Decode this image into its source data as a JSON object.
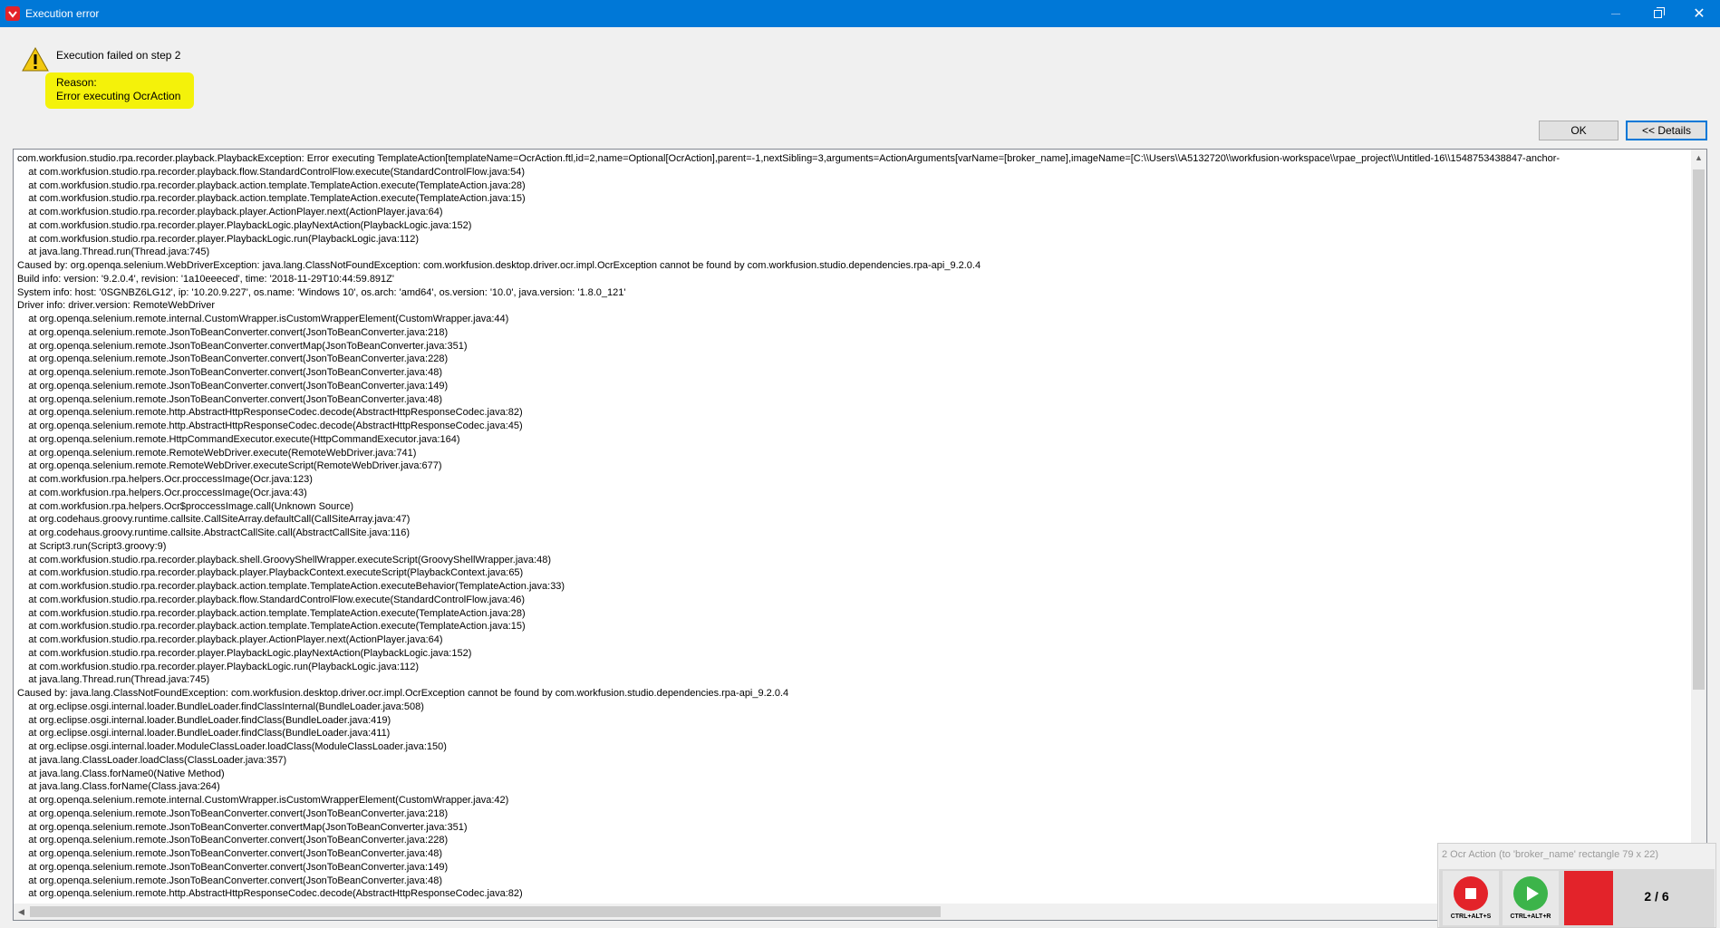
{
  "window": {
    "title": "Execution error",
    "close_symbol": "✕",
    "colors": {
      "titlebar": "#0078d7",
      "highlight": "#f4f20a",
      "stop": "#e3232a",
      "play": "#3cb44a"
    }
  },
  "message": {
    "main": "Execution failed on step 2",
    "reason_label": "Reason:",
    "reason_value": "Error executing OcrAction",
    "icon": "warning-icon"
  },
  "buttons": {
    "ok": "OK",
    "details": "<< Details"
  },
  "log": {
    "lines": [
      "com.workfusion.studio.rpa.recorder.playback.PlaybackException: Error executing TemplateAction[templateName=OcrAction.ftl,id=2,name=Optional[OcrAction],parent=-1,nextSibling=3,arguments=ActionArguments[varName=[broker_name],imageName=[C:\\\\Users\\\\A5132720\\\\workfusion-workspace\\\\rpae_project\\\\Untitled-16\\\\1548753438847-anchor-",
      "    at com.workfusion.studio.rpa.recorder.playback.flow.StandardControlFlow.execute(StandardControlFlow.java:54)",
      "    at com.workfusion.studio.rpa.recorder.playback.action.template.TemplateAction.execute(TemplateAction.java:28)",
      "    at com.workfusion.studio.rpa.recorder.playback.action.template.TemplateAction.execute(TemplateAction.java:15)",
      "    at com.workfusion.studio.rpa.recorder.playback.player.ActionPlayer.next(ActionPlayer.java:64)",
      "    at com.workfusion.studio.rpa.recorder.player.PlaybackLogic.playNextAction(PlaybackLogic.java:152)",
      "    at com.workfusion.studio.rpa.recorder.player.PlaybackLogic.run(PlaybackLogic.java:112)",
      "    at java.lang.Thread.run(Thread.java:745)",
      "Caused by: org.openqa.selenium.WebDriverException: java.lang.ClassNotFoundException: com.workfusion.desktop.driver.ocr.impl.OcrException cannot be found by com.workfusion.studio.dependencies.rpa-api_9.2.0.4",
      "Build info: version: '9.2.0.4', revision: '1a10eeeced', time: '2018-11-29T10:44:59.891Z'",
      "System info: host: '0SGNBZ6LG12', ip: '10.20.9.227', os.name: 'Windows 10', os.arch: 'amd64', os.version: '10.0', java.version: '1.8.0_121'",
      "Driver info: driver.version: RemoteWebDriver",
      "    at org.openqa.selenium.remote.internal.CustomWrapper.isCustomWrapperElement(CustomWrapper.java:44)",
      "    at org.openqa.selenium.remote.JsonToBeanConverter.convert(JsonToBeanConverter.java:218)",
      "    at org.openqa.selenium.remote.JsonToBeanConverter.convertMap(JsonToBeanConverter.java:351)",
      "    at org.openqa.selenium.remote.JsonToBeanConverter.convert(JsonToBeanConverter.java:228)",
      "    at org.openqa.selenium.remote.JsonToBeanConverter.convert(JsonToBeanConverter.java:48)",
      "    at org.openqa.selenium.remote.JsonToBeanConverter.convert(JsonToBeanConverter.java:149)",
      "    at org.openqa.selenium.remote.JsonToBeanConverter.convert(JsonToBeanConverter.java:48)",
      "    at org.openqa.selenium.remote.http.AbstractHttpResponseCodec.decode(AbstractHttpResponseCodec.java:82)",
      "    at org.openqa.selenium.remote.http.AbstractHttpResponseCodec.decode(AbstractHttpResponseCodec.java:45)",
      "    at org.openqa.selenium.remote.HttpCommandExecutor.execute(HttpCommandExecutor.java:164)",
      "    at org.openqa.selenium.remote.RemoteWebDriver.execute(RemoteWebDriver.java:741)",
      "    at org.openqa.selenium.remote.RemoteWebDriver.executeScript(RemoteWebDriver.java:677)",
      "    at com.workfusion.rpa.helpers.Ocr.proccessImage(Ocr.java:123)",
      "    at com.workfusion.rpa.helpers.Ocr.proccessImage(Ocr.java:43)",
      "    at com.workfusion.rpa.helpers.Ocr$proccessImage.call(Unknown Source)",
      "    at org.codehaus.groovy.runtime.callsite.CallSiteArray.defaultCall(CallSiteArray.java:47)",
      "    at org.codehaus.groovy.runtime.callsite.AbstractCallSite.call(AbstractCallSite.java:116)",
      "    at Script3.run(Script3.groovy:9)",
      "    at com.workfusion.studio.rpa.recorder.playback.shell.GroovyShellWrapper.executeScript(GroovyShellWrapper.java:48)",
      "    at com.workfusion.studio.rpa.recorder.playback.player.PlaybackContext.executeScript(PlaybackContext.java:65)",
      "    at com.workfusion.studio.rpa.recorder.playback.action.template.TemplateAction.executeBehavior(TemplateAction.java:33)",
      "    at com.workfusion.studio.rpa.recorder.playback.flow.StandardControlFlow.execute(StandardControlFlow.java:46)",
      "    at com.workfusion.studio.rpa.recorder.playback.action.template.TemplateAction.execute(TemplateAction.java:28)",
      "    at com.workfusion.studio.rpa.recorder.playback.action.template.TemplateAction.execute(TemplateAction.java:15)",
      "    at com.workfusion.studio.rpa.recorder.playback.player.ActionPlayer.next(ActionPlayer.java:64)",
      "    at com.workfusion.studio.rpa.recorder.player.PlaybackLogic.playNextAction(PlaybackLogic.java:152)",
      "    at com.workfusion.studio.rpa.recorder.player.PlaybackLogic.run(PlaybackLogic.java:112)",
      "    at java.lang.Thread.run(Thread.java:745)",
      "Caused by: java.lang.ClassNotFoundException: com.workfusion.desktop.driver.ocr.impl.OcrException cannot be found by com.workfusion.studio.dependencies.rpa-api_9.2.0.4",
      "    at org.eclipse.osgi.internal.loader.BundleLoader.findClassInternal(BundleLoader.java:508)",
      "    at org.eclipse.osgi.internal.loader.BundleLoader.findClass(BundleLoader.java:419)",
      "    at org.eclipse.osgi.internal.loader.BundleLoader.findClass(BundleLoader.java:411)",
      "    at org.eclipse.osgi.internal.loader.ModuleClassLoader.loadClass(ModuleClassLoader.java:150)",
      "    at java.lang.ClassLoader.loadClass(ClassLoader.java:357)",
      "    at java.lang.Class.forName0(Native Method)",
      "    at java.lang.Class.forName(Class.java:264)",
      "    at org.openqa.selenium.remote.internal.CustomWrapper.isCustomWrapperElement(CustomWrapper.java:42)",
      "    at org.openqa.selenium.remote.JsonToBeanConverter.convert(JsonToBeanConverter.java:218)",
      "    at org.openqa.selenium.remote.JsonToBeanConverter.convertMap(JsonToBeanConverter.java:351)",
      "    at org.openqa.selenium.remote.JsonToBeanConverter.convert(JsonToBeanConverter.java:228)",
      "    at org.openqa.selenium.remote.JsonToBeanConverter.convert(JsonToBeanConverter.java:48)",
      "    at org.openqa.selenium.remote.JsonToBeanConverter.convert(JsonToBeanConverter.java:149)",
      "    at org.openqa.selenium.remote.JsonToBeanConverter.convert(JsonToBeanConverter.java:48)",
      "    at org.openqa.selenium.remote.http.AbstractHttpResponseCodec.decode(AbstractHttpResponseCodec.java:82)"
    ]
  },
  "playback_overlay": {
    "caption": "2 Ocr Action (to 'broker_name' rectangle 79 x 22)",
    "stop_shortcut": "CTRL+ALT+S",
    "play_shortcut": "CTRL+ALT+R",
    "step_counter": "2 / 6"
  }
}
